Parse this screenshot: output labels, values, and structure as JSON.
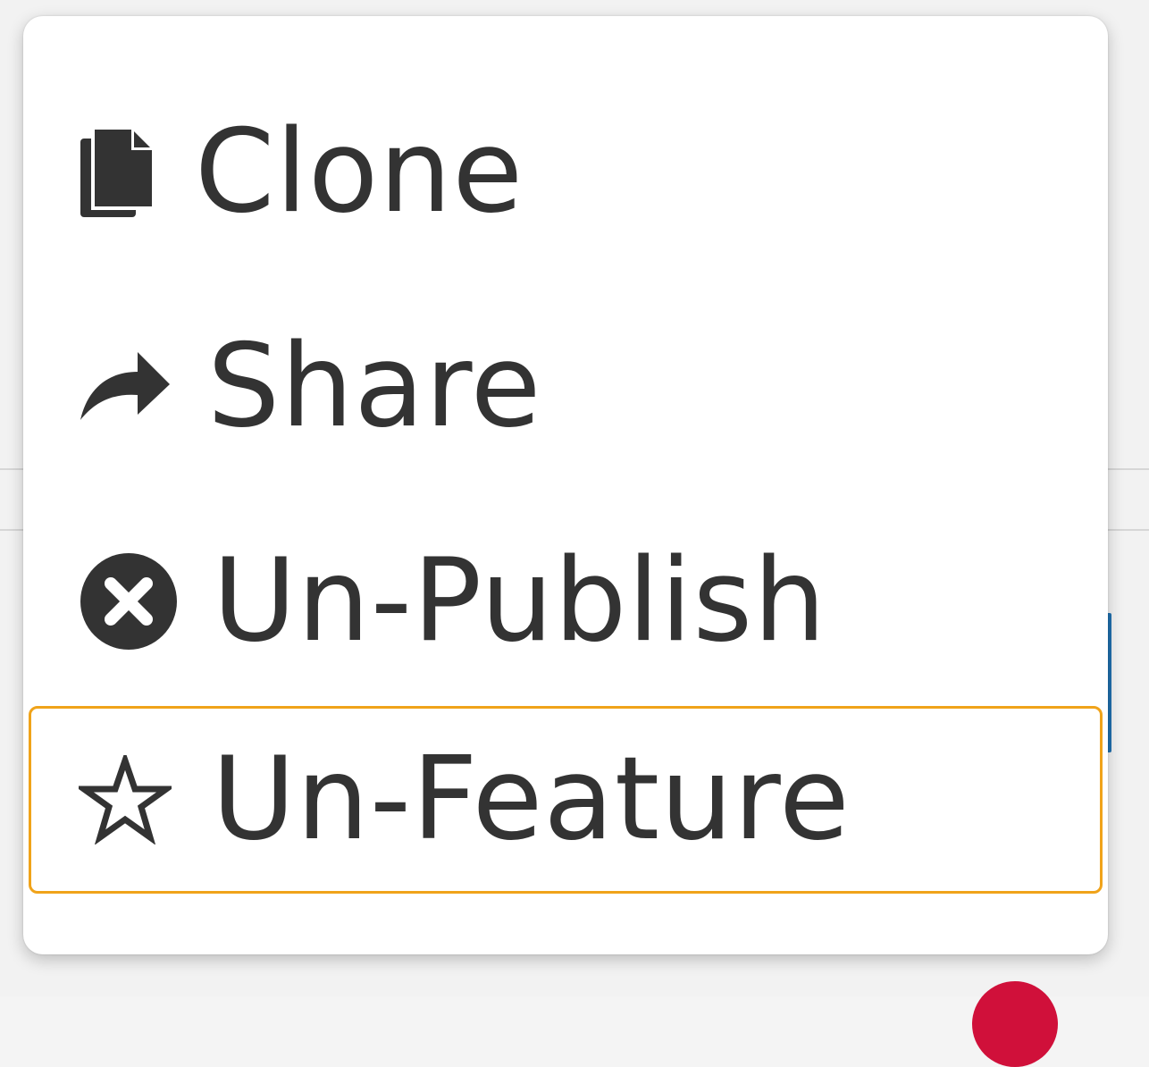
{
  "colors": {
    "menu_background": "#ffffff",
    "text": "#333333",
    "focus_outline": "#f0a31a",
    "background_accent_blue": "#1f6fae",
    "background_accent_red": "#d0103a"
  },
  "menu": {
    "items": [
      {
        "label": "Clone",
        "icon": "clone-icon",
        "focused": false
      },
      {
        "label": "Share",
        "icon": "share-icon",
        "focused": false
      },
      {
        "label": "Un-Publish",
        "icon": "close-circle-icon",
        "focused": false
      },
      {
        "label": "Un-Feature",
        "icon": "star-outline-icon",
        "focused": true
      }
    ]
  }
}
